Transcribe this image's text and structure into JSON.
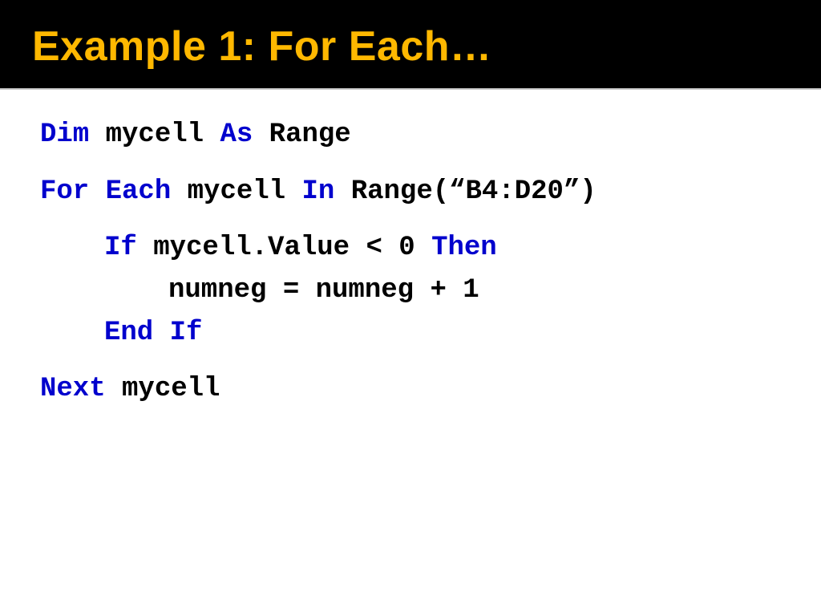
{
  "header": {
    "title": "Example 1: For Each…"
  },
  "code": {
    "line1_kw1": "Dim",
    "line1_var": " mycell ",
    "line1_kw2": "As",
    "line1_type": " Range",
    "line2_kw1": "For",
    "line2_kw2": "Each",
    "line2_var": " mycell ",
    "line2_kw3": "In",
    "line2_rest": " Range(“B4:D20”)",
    "line3_kw1": "If",
    "line3_mid": " mycell.Value < 0 ",
    "line3_kw2": "Then",
    "line4_body": "numneg = numneg + 1",
    "line5_kw1": "End",
    "line5_kw2": "If",
    "line6_kw1": "Next",
    "line6_var": " mycell"
  }
}
